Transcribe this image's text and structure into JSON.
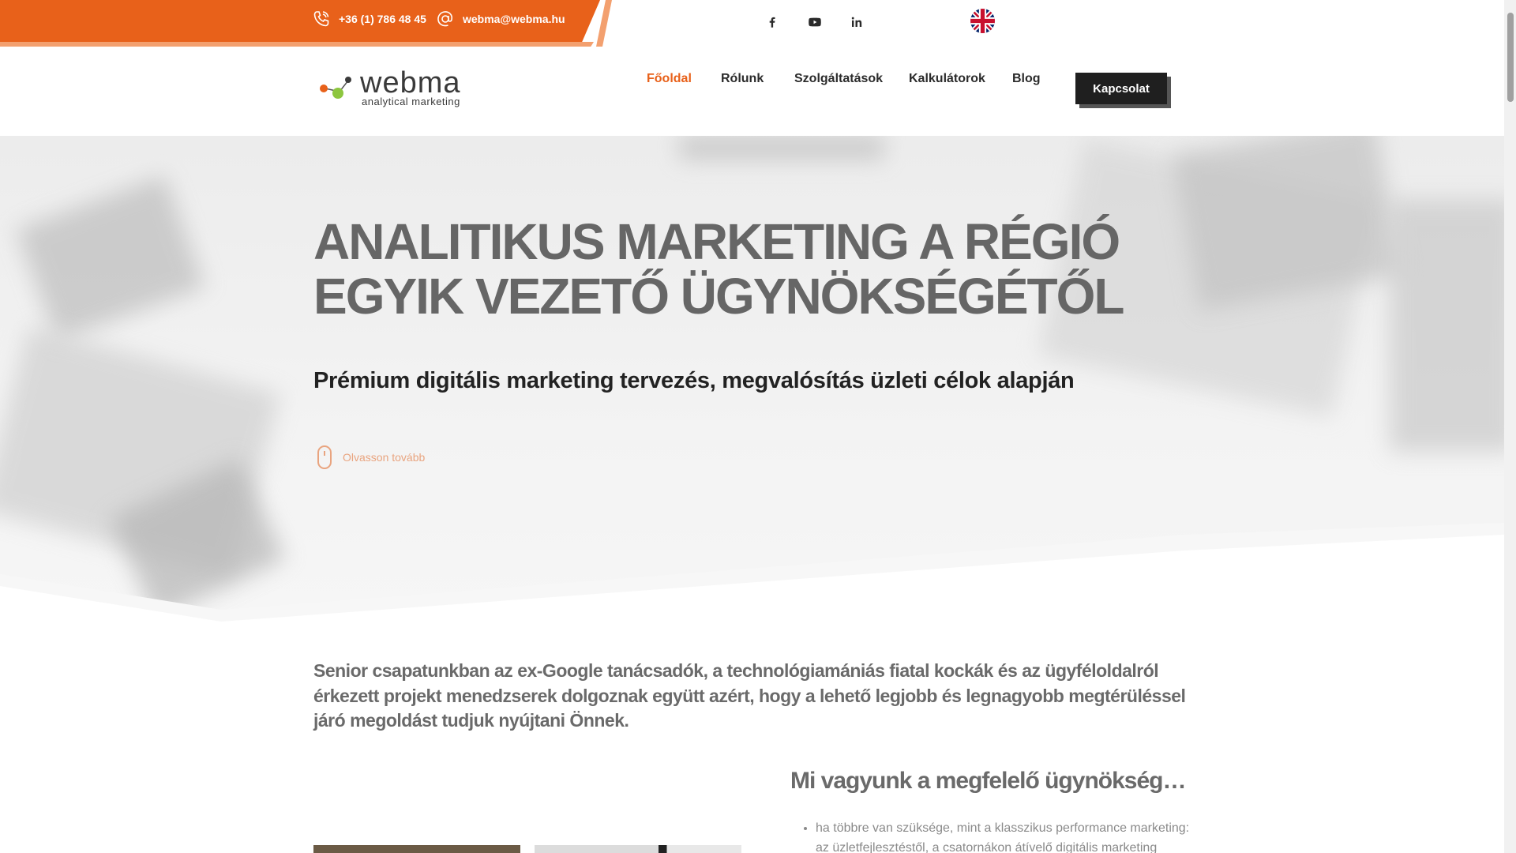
{
  "topbar": {
    "phone": "+36 (1) 786 48 45",
    "email": "webma@webma.hu",
    "social": [
      "facebook-icon",
      "youtube-icon",
      "linkedin-icon"
    ],
    "language_flag": "uk-flag-icon"
  },
  "header": {
    "logo_word": "webma",
    "logo_sub": "analytical marketing",
    "nav": [
      {
        "label": "Főoldal",
        "active": true
      },
      {
        "label": "Rólunk",
        "active": false
      },
      {
        "label": "Szolgáltatások",
        "active": false
      },
      {
        "label": "Kalkulátorok",
        "active": false
      },
      {
        "label": "Blog",
        "active": false
      }
    ],
    "cta_label": "Kapcsolat"
  },
  "hero": {
    "title_line1": "ANALITIKUS MARKETING A RÉGIÓ",
    "title_line2": "EGYIK VEZETŐ ÜGYNÖKSÉGÉTŐL",
    "subtitle": "Prémium digitális marketing tervezés, megvalósítás üzleti célok alapján",
    "read_more": "Olvasson tovább"
  },
  "intro": {
    "text": "Senior csapatunkban az ex-Google tanácsadók, a technológiamániás fiatal kockák és az ügyféloldalról érkezett projekt menedzserek dolgoznak együtt azért, hogy a lehető legjobb és legnagyobb megtérüléssel járó megoldást tudjuk nyújtani Önnek."
  },
  "why": {
    "title": "Mi vagyunk a megfelelő ügynökség…",
    "items": [
      "ha többre van szüksége, mint a klasszikus performance marketing: az üzletfejlesztéstől, a csatornákon átívelő digitális marketing"
    ]
  },
  "colors": {
    "accent": "#e8611a",
    "accent_light": "#f3a06f",
    "dark": "#1f1f1f"
  }
}
